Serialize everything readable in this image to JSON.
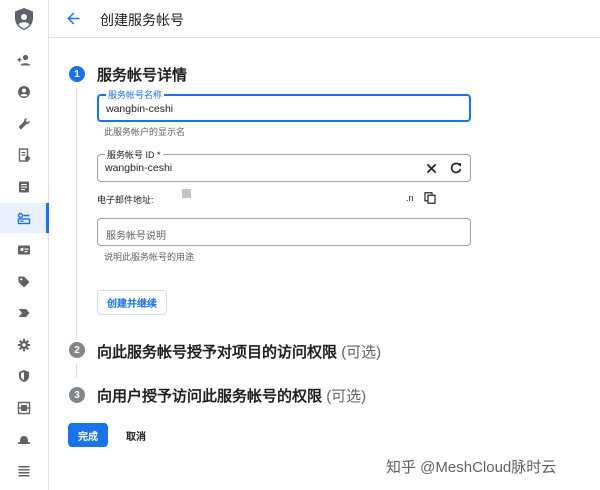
{
  "header": {
    "title": "创建服务帐号"
  },
  "steps": [
    {
      "number": "1",
      "title": "服务帐号详情"
    },
    {
      "number": "2",
      "title": "向此服务帐号授予对项目的访问权限",
      "optional": "(可选)"
    },
    {
      "number": "3",
      "title": "向用户授予访问此服务帐号的权限",
      "optional": "(可选)"
    }
  ],
  "form": {
    "name": {
      "label": "服务帐号名称",
      "value": "wangbin-ceshi",
      "hint": "此服务帐户的显示名"
    },
    "id": {
      "label": "服务帐号 ID *",
      "value": "wangbin-ceshi"
    },
    "email": {
      "label": "电子邮件地址:",
      "suffix": ".n"
    },
    "description": {
      "placeholder": "服务帐号说明",
      "hint": "说明此服务帐号的用途"
    },
    "create_button": "创建并继续"
  },
  "actions": {
    "done": "完成",
    "cancel": "取消"
  },
  "watermark": "知乎 @MeshCloud脉时云",
  "colors": {
    "accent": "#1a73e8",
    "inactive": "#80868b",
    "border": "#dadce0"
  },
  "sidebar": {
    "items": [
      {
        "icon": "person-add-icon"
      },
      {
        "icon": "account-circle-icon"
      },
      {
        "icon": "wrench-icon"
      },
      {
        "icon": "receipt-icon"
      },
      {
        "icon": "article-icon"
      },
      {
        "icon": "service-account-icon",
        "active": true
      },
      {
        "icon": "id-card-icon"
      },
      {
        "icon": "tag-icon"
      },
      {
        "icon": "label-icon"
      },
      {
        "icon": "settings-gear-icon"
      },
      {
        "icon": "shield-icon"
      },
      {
        "icon": "policy-icon"
      },
      {
        "icon": "hat-icon"
      },
      {
        "icon": "list-icon"
      }
    ]
  }
}
